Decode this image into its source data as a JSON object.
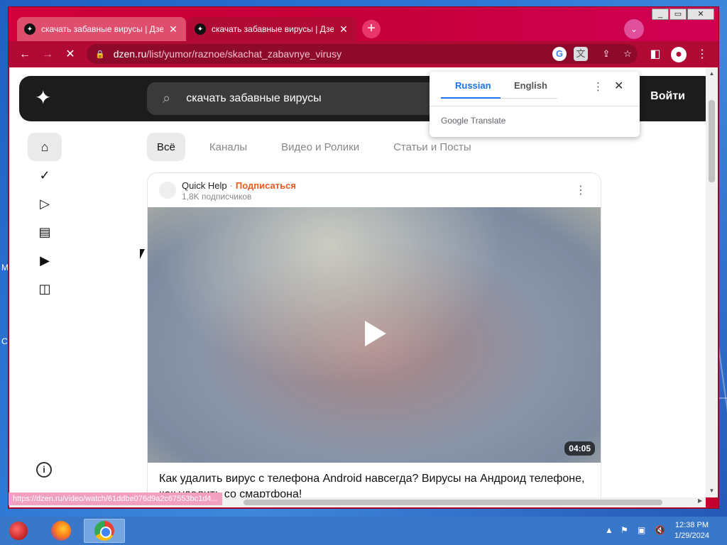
{
  "window": {
    "tabs": [
      {
        "title": "скачать забавные вирусы | Дзен",
        "active": false
      },
      {
        "title": "скачать забавные вирусы | Дзен",
        "active": true
      }
    ],
    "new_tab": "+",
    "tab_search": "⌄"
  },
  "address_bar": {
    "host": "dzen.ru",
    "path": "/list/yumor/raznoe/skachat_zabavnye_virusy"
  },
  "dzen": {
    "search_text": "скачать забавные вирусы",
    "login_label": "Войти",
    "filters": [
      "Всё",
      "Каналы",
      "Видео и Ролики",
      "Статьи и Посты"
    ],
    "card": {
      "channel": "Quick Help",
      "dot": "·",
      "subscribe": "Подписаться",
      "subscribers": "1,8K подписчиков",
      "duration": "04:05",
      "title": "Как удалить вирус с телефона Android навсегда? Вирусы на Андроид телефоне, как удалить со смартфона!"
    }
  },
  "translate_popup": {
    "tab_source": "Russian",
    "tab_target": "English",
    "brand": "Google Translate"
  },
  "status_url": "https://dzen.ru/video/watch/61ddbe076d9a2c67553bc1d4...",
  "taskbar": {
    "time": "12:38 PM",
    "date": "1/29/2024"
  },
  "colors": {
    "browser_theme": "#c3002f",
    "dzen_accent": "#f05a1e",
    "translate_accent": "#1a73e8"
  }
}
